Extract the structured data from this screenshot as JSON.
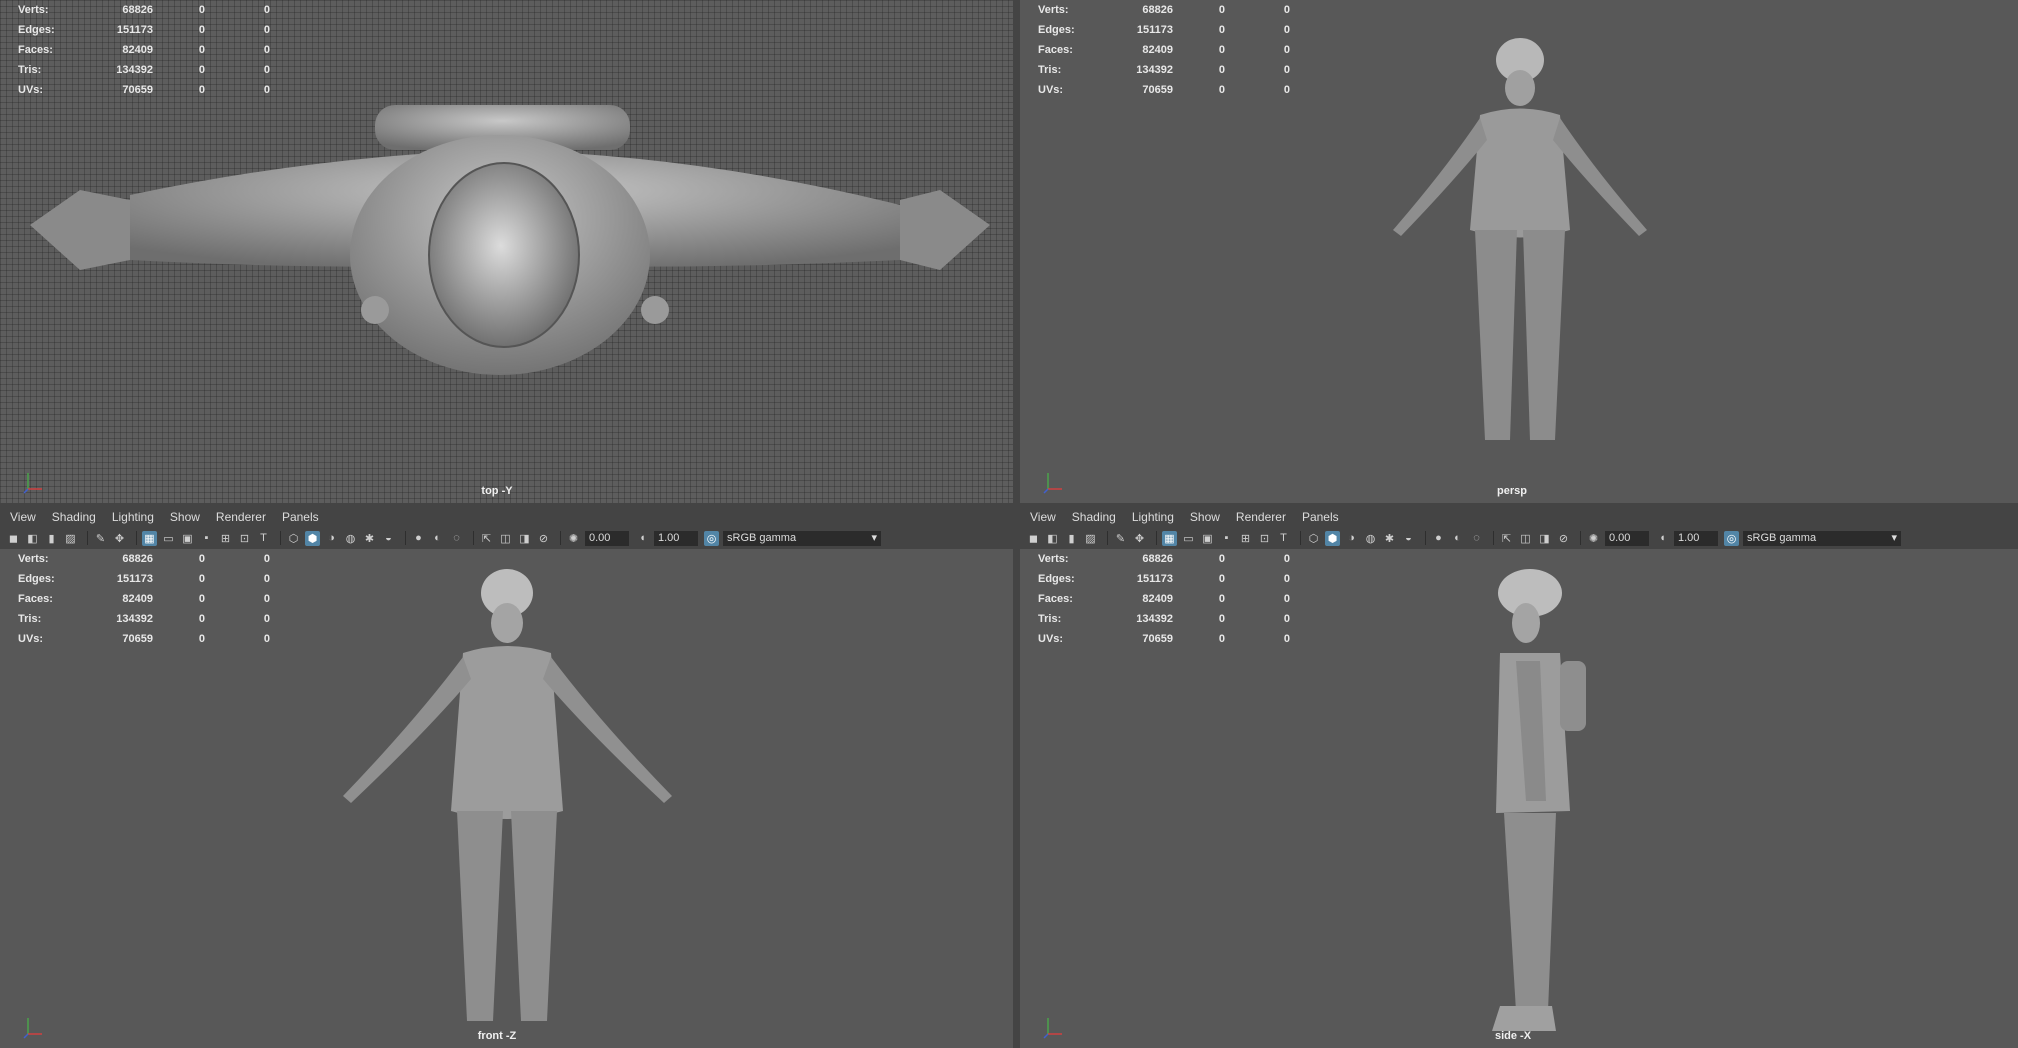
{
  "stats": {
    "verts": {
      "label": "Verts:",
      "values": [
        "68826",
        "0",
        "0"
      ]
    },
    "edges": {
      "label": "Edges:",
      "values": [
        "151173",
        "0",
        "0"
      ]
    },
    "faces": {
      "label": "Faces:",
      "values": [
        "82409",
        "0",
        "0"
      ]
    },
    "tris": {
      "label": "Tris:",
      "values": [
        "134392",
        "0",
        "0"
      ]
    },
    "uvs": {
      "label": "UVs:",
      "values": [
        "70659",
        "0",
        "0"
      ]
    }
  },
  "viewports": {
    "top": {
      "camera": "top -Y"
    },
    "persp": {
      "camera": "persp"
    },
    "front": {
      "camera": "front -Z"
    },
    "side": {
      "camera": "side -X"
    }
  },
  "panel_menu": [
    "View",
    "Shading",
    "Lighting",
    "Show",
    "Renderer",
    "Panels"
  ],
  "toolbar": {
    "exposure": "0.00",
    "gamma": "1.00",
    "color_space": "sRGB gamma"
  },
  "colors": {
    "active_icon": "#5285a6",
    "viewport_bg": "#585858"
  }
}
